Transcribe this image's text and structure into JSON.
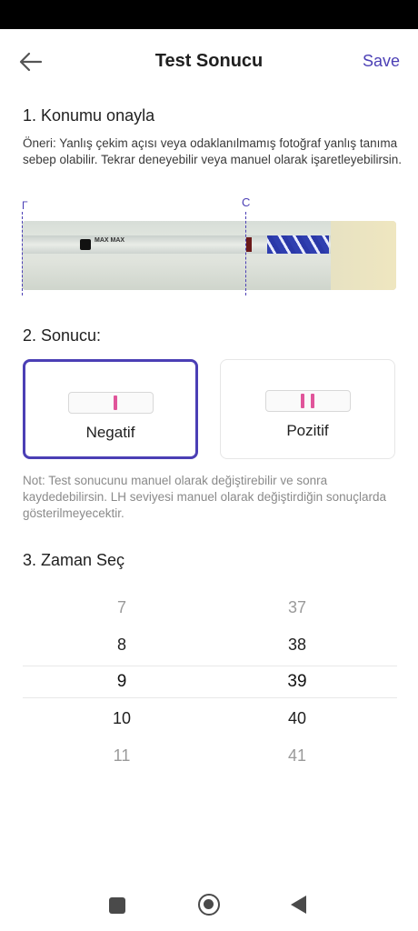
{
  "header": {
    "title": "Test Sonucu",
    "save_label": "Save"
  },
  "section1": {
    "heading": "1. Konumu onayla",
    "hint": "Öneri: Yanlış çekim açısı veya odaklanılmamış fotoğraf yanlış tanıma sebep olabilir. Tekrar deneyebilir veya manuel olarak işaretleyebilirsin.",
    "marker_t": "Γ",
    "marker_c": "C",
    "strip_text": "MAX MAX"
  },
  "section2": {
    "heading": "2. Sonucu:",
    "options": [
      {
        "label": "Negatif",
        "selected": true
      },
      {
        "label": "Pozitif",
        "selected": false
      }
    ],
    "note": "Not: Test sonucunu manuel olarak değiştirebilir ve sonra kaydedebilirsin. LH seviyesi manuel olarak değiştirdiğin sonuçlarda gösterilmeyecektir."
  },
  "section3": {
    "heading": "3. Zaman Seç",
    "hours": [
      "7",
      "8",
      "9",
      "10",
      "11"
    ],
    "minutes": [
      "37",
      "38",
      "39",
      "40",
      "41"
    ],
    "selected_hour": "9",
    "selected_minute": "39"
  },
  "colors": {
    "accent": "#4b3fb5",
    "test_line": "#e0559a"
  },
  "nav": {
    "icons": [
      "recent-apps-icon",
      "home-icon",
      "back-triangle-icon"
    ]
  }
}
